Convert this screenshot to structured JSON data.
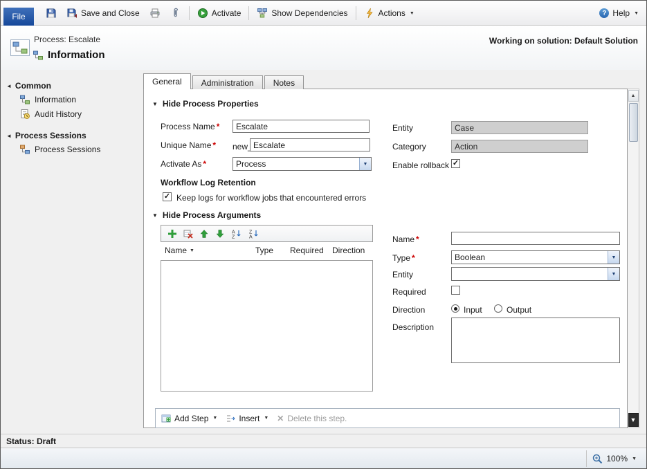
{
  "required_marker": "*",
  "icons": {
    "caret_down": "▼",
    "collapse_down": "▼",
    "collapse_left": "◄",
    "check": "✓",
    "delete_x": "✕",
    "scroll_up": "▲",
    "scroll_down": "▼",
    "help_mark": "?"
  },
  "toolbar": {
    "file": "File",
    "save_and_close": "Save and Close",
    "activate": "Activate",
    "show_dependencies": "Show Dependencies",
    "actions": "Actions",
    "help": "Help"
  },
  "header": {
    "process": "Process: Escalate",
    "title": "Information",
    "working_on_solution": "Working on solution: Default Solution"
  },
  "sidebar": {
    "sections": [
      {
        "label": "Common",
        "items": [
          {
            "label": "Information"
          },
          {
            "label": "Audit History"
          }
        ]
      },
      {
        "label": "Process Sessions",
        "items": [
          {
            "label": "Process Sessions"
          }
        ]
      }
    ]
  },
  "tabs": [
    {
      "label": "General"
    },
    {
      "label": "Administration"
    },
    {
      "label": "Notes"
    }
  ],
  "properties": {
    "section_title": "Hide Process Properties",
    "process_name": {
      "label": "Process Name",
      "value": "Escalate"
    },
    "unique_name": {
      "label": "Unique Name",
      "prefix": "new_",
      "value": "Escalate"
    },
    "activate_as": {
      "label": "Activate As",
      "value": "Process"
    },
    "entity": {
      "label": "Entity",
      "value": "Case"
    },
    "category": {
      "label": "Category",
      "value": "Action"
    },
    "enable_rollback": {
      "label": "Enable rollback",
      "checked": true
    }
  },
  "workflow_log": {
    "title": "Workflow Log Retention",
    "keep_logs": "Keep logs for workflow jobs that encountered errors",
    "checked": true
  },
  "arguments": {
    "section_title": "Hide Process Arguments",
    "columns": [
      "Name",
      "Type",
      "Required",
      "Direction"
    ],
    "rows": [],
    "form": {
      "name_label": "Name",
      "name_value": "",
      "type_label": "Type",
      "type_value": "Boolean",
      "entity_label": "Entity",
      "entity_value": "",
      "required_label": "Required",
      "direction_label": "Direction",
      "direction_options": [
        "Input",
        "Output"
      ],
      "direction_selected": "Input",
      "description_label": "Description",
      "description_value": ""
    }
  },
  "step_bar": {
    "add_step": "Add Step",
    "insert": "Insert",
    "delete_step": "Delete this step."
  },
  "status_bar": {
    "status": "Status: Draft"
  },
  "zoom_bar": {
    "zoom": "100%"
  }
}
